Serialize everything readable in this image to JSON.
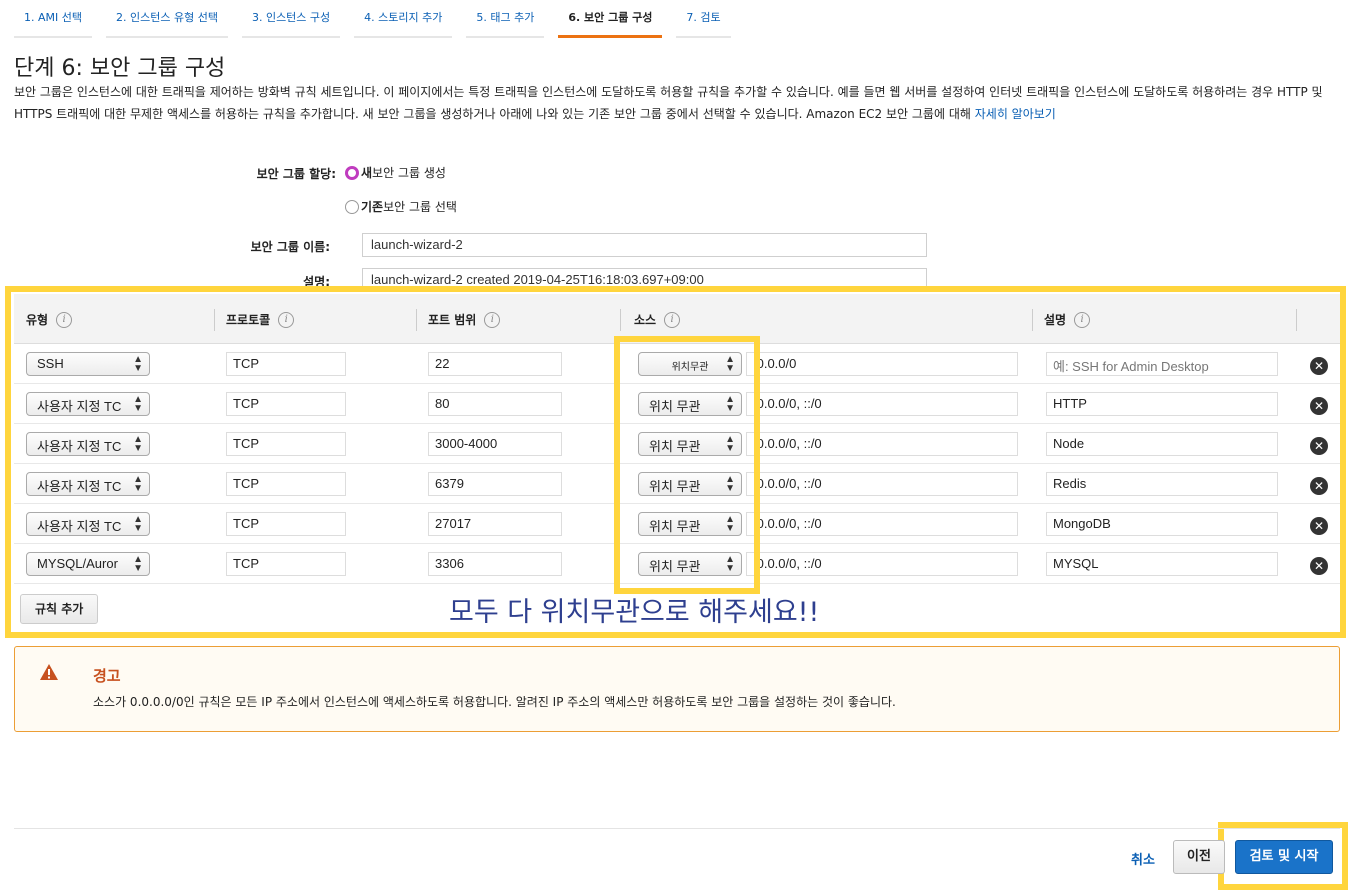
{
  "tabs": [
    {
      "label": "1. AMI 선택"
    },
    {
      "label": "2. 인스턴스 유형 선택"
    },
    {
      "label": "3. 인스턴스 구성"
    },
    {
      "label": "4. 스토리지 추가"
    },
    {
      "label": "5. 태그 추가"
    },
    {
      "label": "6. 보안 그룹 구성"
    },
    {
      "label": "7. 검토"
    }
  ],
  "page": {
    "title": "단계 6: 보안 그룹 구성",
    "description": "보안 그룹은 인스턴스에 대한 트래픽을 제어하는 방화벽 규칙 세트입니다. 이 페이지에서는 특정 트래픽을 인스턴스에 도달하도록 허용할 규칙을 추가할 수 있습니다. 예를 들면 웹 서버를 설정하여 인터넷 트래픽을 인스턴스에 도달하도록 허용하려는 경우 HTTP 및 HTTPS 트래픽에 대한 무제한 액세스를 허용하는 규칙을 추가합니다. 새 보안 그룹을 생성하거나 아래에 나와 있는 기존 보안 그룹 중에서 선택할 수 있습니다. Amazon EC2 보안 그룹에 대해 ",
    "learn_more": "자세히 알아보기"
  },
  "form": {
    "assign_label": "보안 그룹 할당:",
    "option_new_bold": "새",
    "option_new_rest": " 보안 그룹 생성",
    "option_existing_bold": "기존",
    "option_existing_rest": " 보안 그룹 선택",
    "name_label": "보안 그룹 이름:",
    "name_value": "launch-wizard-2",
    "desc_label": "설명:",
    "desc_value": "launch-wizard-2 created 2019-04-25T16:18:03.697+09:00"
  },
  "table": {
    "headers": {
      "type": "유형",
      "protocol": "프로토콜",
      "port": "포트 범위",
      "source": "소스",
      "description": "설명"
    },
    "info_glyph": "i",
    "rows": [
      {
        "type": "SSH",
        "protocol": "TCP",
        "port": "22",
        "source": "위치무관",
        "cidr": ".0.0.0/0",
        "desc": "예: SSH for Admin Desktop"
      },
      {
        "type": "사용자 지정 TC",
        "protocol": "TCP",
        "port": "80",
        "source": "위치 무관",
        "cidr": ".0.0.0/0, ::/0",
        "desc": "HTTP"
      },
      {
        "type": "사용자 지정 TC",
        "protocol": "TCP",
        "port": "3000-4000",
        "source": "위치 무관",
        "cidr": ".0.0.0/0, ::/0",
        "desc": "Node"
      },
      {
        "type": "사용자 지정 TC",
        "protocol": "TCP",
        "port": "6379",
        "source": "위치 무관",
        "cidr": ".0.0.0/0, ::/0",
        "desc": "Redis"
      },
      {
        "type": "사용자 지정 TC",
        "protocol": "TCP",
        "port": "27017",
        "source": "위치 무관",
        "cidr": ".0.0.0/0, ::/0",
        "desc": "MongoDB"
      },
      {
        "type": "MYSQL/Auror",
        "protocol": "TCP",
        "port": "3306",
        "source": "위치 무관",
        "cidr": ".0.0.0/0, ::/0",
        "desc": "MYSQL"
      }
    ],
    "add_rule": "규칙 추가"
  },
  "annotation": "모두 다 위치무관으로 해주세요!!",
  "warning": {
    "title": "경고",
    "text": "소스가 0.0.0.0/0인 규칙은 모든 IP 주소에서 인스턴스에 액세스하도록 허용합니다. 알려진 IP 주소의 액세스만 허용하도록 보안 그룹을 설정하는 것이 좋습니다.",
    "icon": "warning-triangle-icon"
  },
  "footer": {
    "cancel": "취소",
    "previous": "이전",
    "review_launch": "검토 및 시작"
  },
  "colors": {
    "accent_tab": "#ec7211",
    "link": "#0a5fb4",
    "primary_button": "#1a73c9",
    "highlight": "#ffd53d",
    "warning_border": "#ec9e35",
    "radio_selected": "#c03cbf"
  }
}
